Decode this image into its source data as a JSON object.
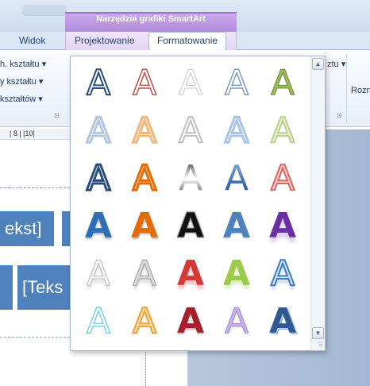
{
  "contextual_group": {
    "title": "Narzędzia grafiki SmartArt"
  },
  "tabs": [
    {
      "label": "Widok"
    },
    {
      "label": "Projektowanie"
    },
    {
      "label": "Formatowanie",
      "active": true
    }
  ],
  "ribbon": {
    "left_items": [
      "h. kształtu ▾",
      "y kształtu ▾",
      "kształtów ▾"
    ],
    "right_item": "ztu ▾",
    "far_right": "Rozn",
    "launcher": "⊡"
  },
  "ruler": {
    "marks": "| 8 |  |10|"
  },
  "document": {
    "box1_text": "ekst]",
    "box2_text": "[Teks",
    "handle_dots": "····"
  },
  "gallery": {
    "glyph": "A",
    "scroll_up": "▲",
    "scroll_down": "▼",
    "resize_grip": "⠿",
    "styles": [
      [
        "outline-blue",
        "outline-red",
        "outline-gray",
        "outline-lightblue",
        "fill-green"
      ],
      [
        "outline-pale-blue",
        "outline-orange",
        "outline-silver",
        "outline-pale-blue2",
        "outline-pale-green"
      ],
      [
        "bevel-navy",
        "bevel-orange",
        "gradient-gray",
        "gradient-blue",
        "outline-salmon"
      ],
      [
        "bold-blue",
        "bold-orange",
        "bold-black",
        "bold-steelblue",
        "bold-purple"
      ],
      [
        "reflect-silver",
        "reflect-gray",
        "reflect-red",
        "reflect-green",
        "reflect-blue"
      ],
      [
        "outline-cyan",
        "glow-orange",
        "bold-crimson",
        "soft-lavender",
        "3d-navy"
      ]
    ]
  },
  "colors": {
    "ribbon_text": "#1f3b63",
    "contextual_header": "#b28bdc",
    "smartart_fill": "#4f81bd"
  }
}
